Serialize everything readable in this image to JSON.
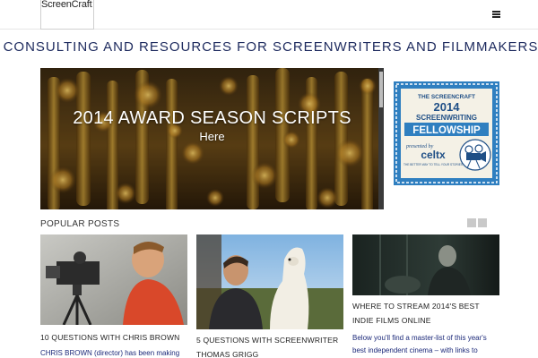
{
  "header": {
    "logo_text": "ScreenCraft",
    "menu_icon": "hamburger-menu-icon"
  },
  "tagline": "CONSULTING AND RESOURCES FOR SCREENWRITERS AND FILMMAKERS",
  "hero": {
    "title": "2014 AWARD SEASON SCRIPTS",
    "link": "Here"
  },
  "badge": {
    "brand": "THE SCREENCRAFT",
    "year": "2014",
    "line1": "SCREENWRITING",
    "line2": "FELLOWSHIP",
    "presented_by": "presented by",
    "sponsor": "celtx",
    "sponsor_tagline": "THE BETTER WAY TO TELL YOUR STORIES"
  },
  "popular": {
    "heading": "POPULAR POSTS",
    "pager_icons": [
      "arrow-left-icon",
      "arrow-right-icon"
    ],
    "posts": [
      {
        "title": "10 QUESTIONS WITH CHRIS BROWN",
        "excerpt": "CHRIS BROWN (director) has been making"
      },
      {
        "title": "5 QUESTIONS WITH SCREENWRITER THOMAS GRIGG",
        "excerpt": ""
      },
      {
        "title": "WHERE TO STREAM 2014'S BEST INDIE FILMS ONLINE",
        "excerpt": "Below you'll find a master-list of this year's best independent cinema – with links to stream the"
      }
    ]
  },
  "colors": {
    "tagline": "#1d2a5e",
    "badge_blue": "#2f7fc0",
    "link_blue": "#1d2a7a"
  }
}
